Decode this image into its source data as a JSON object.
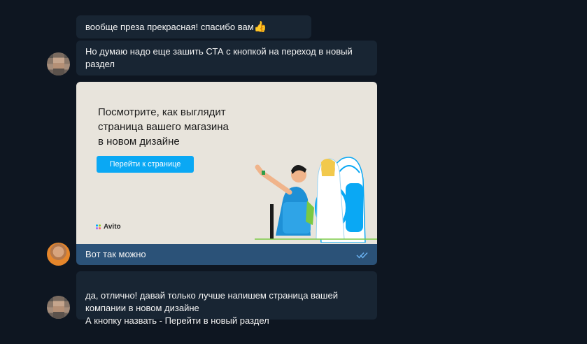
{
  "messages": [
    {
      "text": "вообще преза прекрасная! спасибо вам",
      "emoji": "👍"
    },
    {
      "text": "Но думаю надо еще зашить СТА с кнопкой на переход в новый раздел"
    },
    {
      "image": {
        "headline": "Посмотрите, как выглядит\nстраница вашего магазина\nв новом дизайне",
        "button_label": "Перейти к странице",
        "brand": "Avito"
      },
      "caption": "Вот так можно"
    },
    {
      "text": "да, отлично! давай только лучше напишем страница вашей компании в новом дизайне\nА кнопку назвать - Перейти в новый раздел"
    }
  ],
  "colors": {
    "background": "#0e1621",
    "incoming_bubble": "#182533",
    "outgoing_bubble": "#2b5278",
    "cta": "#0aa8f4",
    "read_ticks": "#6ab2f2"
  },
  "icons": [
    "thumbs-up-emoji",
    "read-double-check-icon",
    "avito-logo-icon"
  ]
}
